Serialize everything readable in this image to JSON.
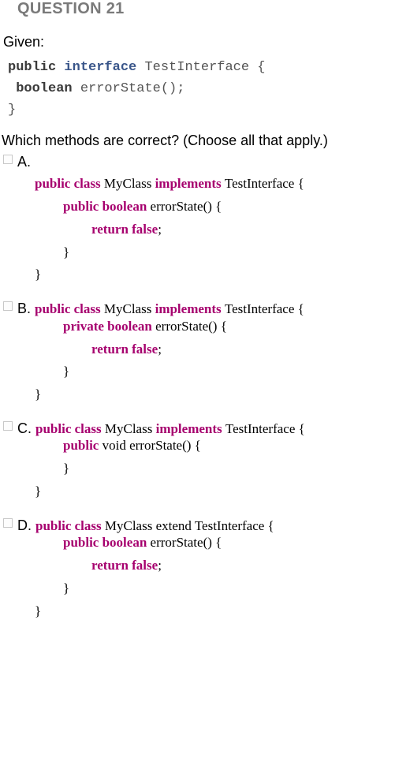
{
  "question": {
    "header": "QUESTION 21",
    "given_label": "Given:",
    "prompt": "Which methods are correct? (Choose all that apply.)"
  },
  "given_code": {
    "l1a": "public ",
    "l1b": "interface ",
    "l1c": "TestInterface {",
    "l2a": "boolean ",
    "l2b": "errorState();",
    "l3": "}"
  },
  "opts": {
    "a": {
      "letter": "A.",
      "l1_kw": "public class ",
      "l1_id": "MyClass ",
      "l1_kw2": "implements ",
      "l1_id2": "TestInterface {",
      "l2_kw": "public boolean ",
      "l2_id": "errorState() {",
      "l3_kw": "return false",
      "l3_t": ";",
      "l4": "}",
      "l5": "}"
    },
    "b": {
      "letter": "B. ",
      "l1_kw": "public class ",
      "l1_id": "MyClass ",
      "l1_kw2": "implements ",
      "l1_id2": "TestInterface {",
      "l2_kw": "private boolean ",
      "l2_id": "errorState() {",
      "l3_kw": "return false",
      "l3_t": ";",
      "l4": "}",
      "l5": "}"
    },
    "c": {
      "letter": "C. ",
      "l1_kw": "public class ",
      "l1_id": "MyClass ",
      "l1_kw2": "implements ",
      "l1_id2": "TestInterface {",
      "l2_kw": "public ",
      "l2_id": "void errorState() {",
      "l4": "}",
      "l5": "}"
    },
    "d": {
      "letter": "D. ",
      "l1_kw": "public class ",
      "l1_id": "MyClass extend TestInterface {",
      "l2_kw": "public boolean ",
      "l2_id": "errorState() {",
      "l3_kw": "return false",
      "l3_t": ";",
      "l4": "}",
      "l5": "}"
    }
  }
}
